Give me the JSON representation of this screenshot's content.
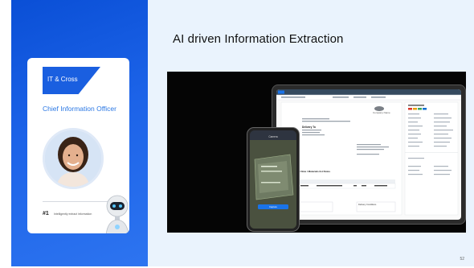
{
  "slide": {
    "title": "AI driven Information Extraction",
    "page_number": "52"
  },
  "persona_card": {
    "tag": "IT & Cross",
    "role": "Chief Information Officer",
    "rank": "#1",
    "rank_text": "Intelligently extract information"
  },
  "document_app": {
    "header_title": "Delivery To",
    "section_title": "Delivery Note / Materials list Notes",
    "table_columns": [
      "Item",
      "Material",
      "Material Description",
      "Qty",
      "Unit",
      "Total"
    ],
    "table_row": [
      "1",
      "TXXX",
      "Computer Visual number",
      "3",
      "EA",
      "USD 1000"
    ],
    "footer_left": "Vendor",
    "footer_right": "Delivery Conditions",
    "logo_text": "Company Name"
  },
  "phone_app": {
    "header": "Camera",
    "button_label": "Capture"
  },
  "colors": {
    "brand_blue": "#1a5fe0",
    "panel_bg": "#eaf3fd",
    "stage_bg": "#050505"
  }
}
